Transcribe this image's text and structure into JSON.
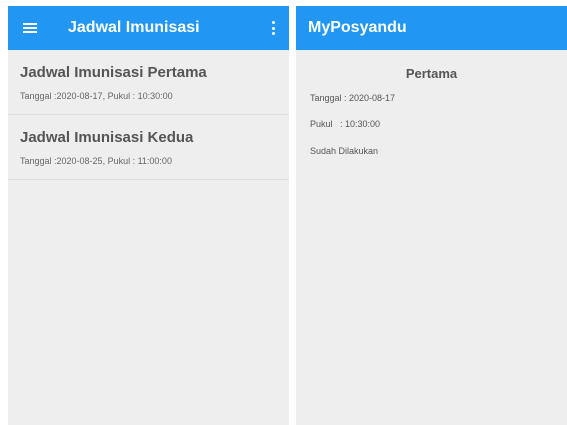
{
  "colors": {
    "appbar": "#2196f3",
    "background": "#eeeeee"
  },
  "left_screen": {
    "appbar": {
      "title": "Jadwal Imunisasi",
      "menu_icon": "hamburger-menu-icon",
      "overflow_icon": "more-vert-icon"
    },
    "items": [
      {
        "title": "Jadwal Imunisasi Pertama",
        "subtitle": "Tanggal :2020-08-17, Pukul : 10:30:00"
      },
      {
        "title": "Jadwal Imunisasi Kedua",
        "subtitle": "Tanggal :2020-08-25, Pukul : 11:00:00"
      }
    ]
  },
  "right_screen": {
    "appbar": {
      "title": "MyPosyandu"
    },
    "detail": {
      "heading": "Pertama",
      "date": "Tanggal : 2020-08-17",
      "time": "Pukul   : 10:30:00",
      "status": "Sudah Dilakukan"
    }
  }
}
